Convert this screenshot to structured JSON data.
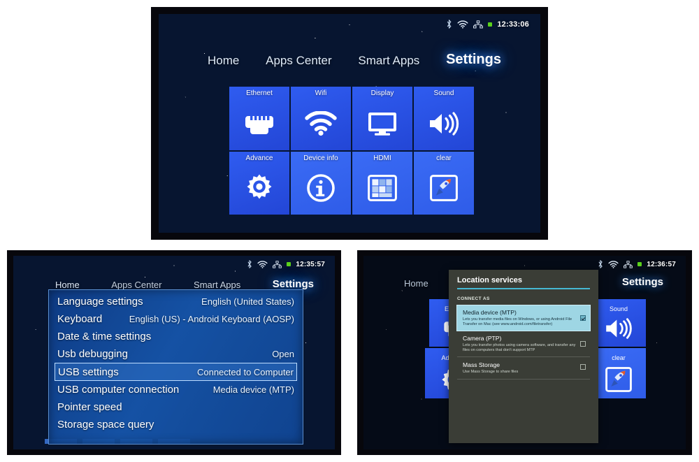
{
  "panels": {
    "top": {
      "name": "settings-home-screen",
      "statusbar": {
        "bluetooth": "bluetooth-icon",
        "wifi": "wifi-icon",
        "ethernet": "ethernet-icon",
        "indicator": "green-status-dot",
        "time": "12:33:06"
      },
      "nav": [
        {
          "label": "Home",
          "selected": false
        },
        {
          "label": "Apps Center",
          "selected": false
        },
        {
          "label": "Smart Apps",
          "selected": false
        },
        {
          "label": "Settings",
          "selected": true
        }
      ],
      "tiles": [
        {
          "label": "Ethernet",
          "icon": "ethernet-port-icon"
        },
        {
          "label": "Wifi",
          "icon": "wifi-icon"
        },
        {
          "label": "Display",
          "icon": "monitor-icon"
        },
        {
          "label": "Sound",
          "icon": "speaker-volume-icon"
        },
        {
          "label": "Advance",
          "icon": "gear-icon"
        },
        {
          "label": "Device info",
          "icon": "info-circle-icon"
        },
        {
          "label": "HDMI",
          "icon": "tiles-grid-icon"
        },
        {
          "label": "clear",
          "icon": "rocket-icon"
        }
      ]
    },
    "bottom_left": {
      "name": "usb-settings-list-screen",
      "statusbar": {
        "bluetooth": "bluetooth-icon",
        "wifi": "wifi-icon",
        "ethernet": "ethernet-icon",
        "indicator": "green-status-dot",
        "time": "12:35:57"
      },
      "nav": [
        {
          "label": "Home",
          "selected": false
        },
        {
          "label": "Apps Center",
          "selected": false
        },
        {
          "label": "Smart Apps",
          "selected": false
        },
        {
          "label": "Settings",
          "selected": true
        }
      ],
      "rows": [
        {
          "label": "Language settings",
          "value": "English (United States)",
          "selected": false
        },
        {
          "label": "Keyboard",
          "value": "English (US) - Android Keyboard (AOSP)",
          "selected": false
        },
        {
          "label": "Date & time settings",
          "value": "",
          "selected": false
        },
        {
          "label": "Usb debugging",
          "value": "Open",
          "selected": false
        },
        {
          "label": "USB settings",
          "value": "Connected to Computer",
          "selected": true
        },
        {
          "label": "USB computer connection",
          "value": "Media device (MTP)",
          "selected": false
        },
        {
          "label": "Pointer speed",
          "value": "",
          "selected": false
        },
        {
          "label": "Storage space query",
          "value": "",
          "selected": false
        }
      ]
    },
    "bottom_right": {
      "name": "usb-connect-as-dialog-screen",
      "statusbar": {
        "bluetooth": "bluetooth-icon",
        "wifi": "wifi-icon",
        "ethernet": "ethernet-icon",
        "indicator": "green-status-dot",
        "time": "12:36:57"
      },
      "nav": [
        {
          "label": "Home",
          "selected": false
        },
        {
          "label": "Settings",
          "selected": true
        }
      ],
      "background_tiles": [
        {
          "label": "Ethernet",
          "icon": "ethernet-port-icon"
        },
        {
          "label": "Sound",
          "icon": "speaker-volume-icon"
        },
        {
          "label": "Advance",
          "icon": "gear-icon"
        },
        {
          "label": "clear",
          "icon": "rocket-icon"
        }
      ],
      "dialog": {
        "title": "Location services",
        "section_label": "CONNECT AS",
        "options": [
          {
            "name": "Media device (MTP)",
            "desc": "Lets you transfer media files on Windows, or using Android File Transfer on Mac (see www.android.com/filetransfer)",
            "checked": true,
            "selected": true
          },
          {
            "name": "Camera (PTP)",
            "desc": "Lets you transfer photos using camera software, and transfer any files on computers that don't support MTP",
            "checked": false,
            "selected": false
          },
          {
            "name": "Mass Storage",
            "desc": "Use Mass Storage to share files",
            "checked": false,
            "selected": false
          }
        ]
      }
    }
  },
  "colors": {
    "tile_blue": "#2b55e8",
    "accent_cyan": "#46b9d4",
    "dialog_bg": "#3a3d36",
    "selected_option": "#9ed6e4",
    "status_green": "#5bd11a"
  }
}
